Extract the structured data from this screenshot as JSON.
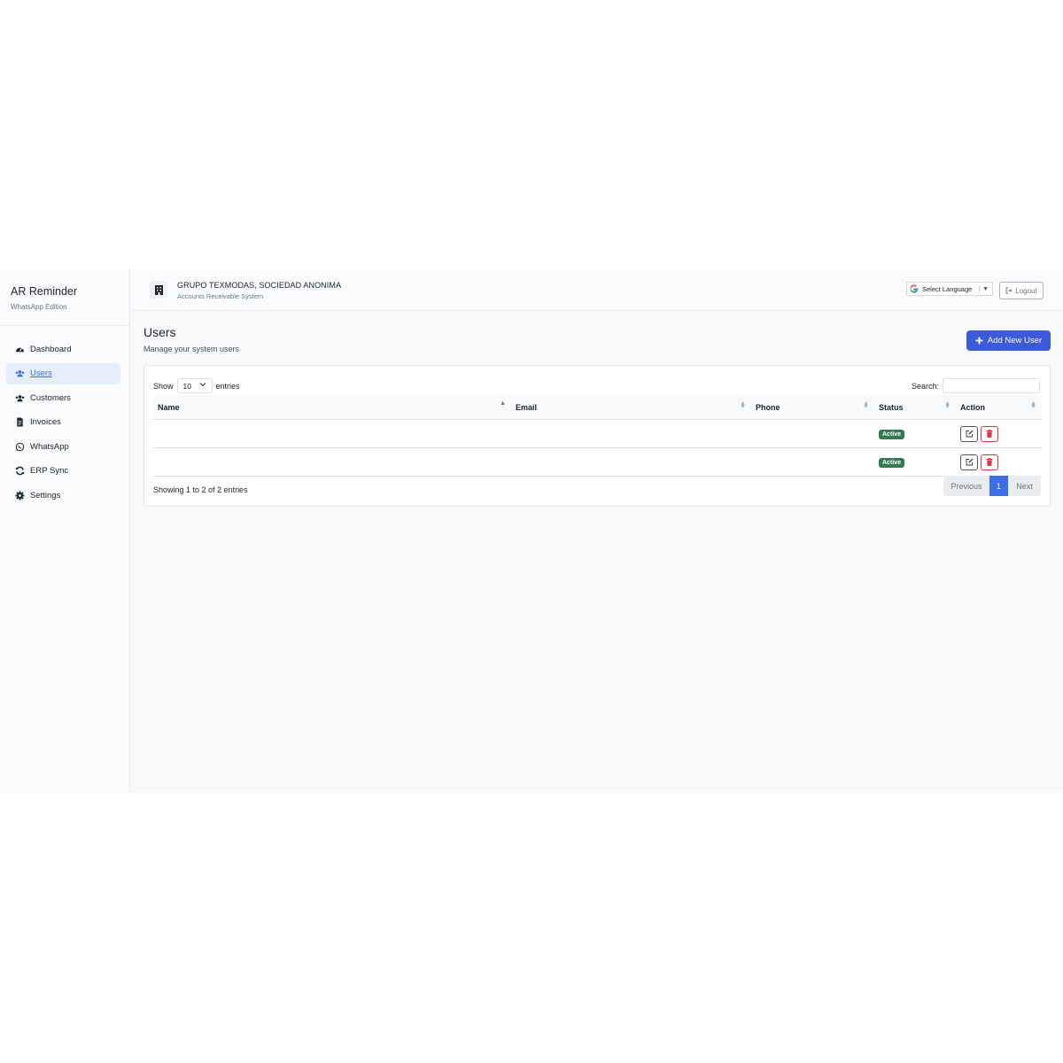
{
  "brand": {
    "title": "AR Reminder",
    "subtitle": "WhatsApp Edition"
  },
  "sidebar": {
    "items": [
      {
        "label": "Dashboard",
        "icon": "dashboard-icon"
      },
      {
        "label": "Users",
        "icon": "users-icon",
        "active": true
      },
      {
        "label": "Customers",
        "icon": "customers-icon"
      },
      {
        "label": "Invoices",
        "icon": "invoice-icon"
      },
      {
        "label": "WhatsApp",
        "icon": "whatsapp-icon"
      },
      {
        "label": "ERP Sync",
        "icon": "sync-icon"
      },
      {
        "label": "Settings",
        "icon": "gear-icon"
      }
    ]
  },
  "header": {
    "company": "GRUPO TEXMODAS, SOCIEDAD ANONIMA",
    "system": "Accounts Receivable System",
    "language": "Select Language",
    "logout": "Logout"
  },
  "page": {
    "title": "Users",
    "subtitle": "Manage your system users",
    "add_button": "Add New User"
  },
  "table_controls": {
    "show": "Show",
    "entries_value": "10",
    "entries": "entries",
    "search": "Search:"
  },
  "table": {
    "columns": [
      "Name",
      "Email",
      "Phone",
      "Status",
      "Action"
    ],
    "rows": [
      {
        "name": "",
        "email": "",
        "phone": "",
        "status": "Active"
      },
      {
        "name": "",
        "email": "",
        "phone": "",
        "status": "Active"
      }
    ]
  },
  "footer": {
    "info": "Showing 1 to 2 of 2 entries",
    "previous": "Previous",
    "page": "1",
    "next": "Next"
  },
  "colors": {
    "accent": "#3b5bdb",
    "active_page": "#3b6ee8",
    "status_active": "#2e7d52",
    "delete": "#dc3545"
  }
}
